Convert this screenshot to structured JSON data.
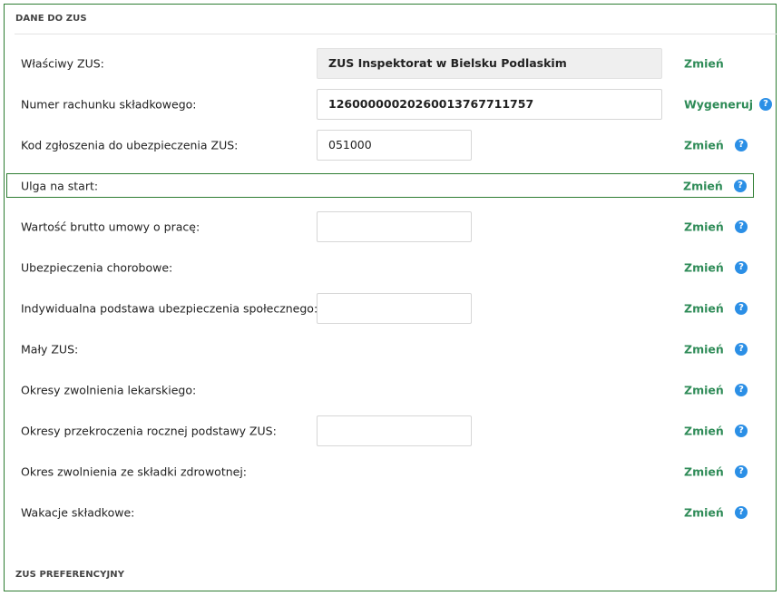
{
  "sections": {
    "main_title": "DANE DO ZUS",
    "next_title": "ZUS PREFERENCYJNY"
  },
  "rows": [
    {
      "label": "Właściwy ZUS:",
      "value": "ZUS Inspektorat w Bielsku Podlaskim",
      "action": "Zmień"
    },
    {
      "label": "Numer rachunku składkowego:",
      "value": "12600000020260013767711757",
      "action": "Wygeneruj",
      "help": "?"
    },
    {
      "label": "Kod zgłoszenia do ubezpieczenia ZUS:",
      "value": "051000",
      "action": "Zmień",
      "help": "?"
    },
    {
      "label": "Ulga na start:",
      "action": "Zmień",
      "help": "?"
    },
    {
      "label": "Wartość brutto umowy o pracę:",
      "value": "",
      "action": "Zmień",
      "help": "?"
    },
    {
      "label": "Ubezpieczenia chorobowe:",
      "action": "Zmień",
      "help": "?"
    },
    {
      "label": "Indywidualna podstawa ubezpieczenia społecznego:",
      "value": "",
      "action": "Zmień",
      "help": "?"
    },
    {
      "label": "Mały ZUS:",
      "action": "Zmień",
      "help": "?"
    },
    {
      "label": "Okresy zwolnienia lekarskiego:",
      "action": "Zmień",
      "help": "?"
    },
    {
      "label": "Okresy przekroczenia rocznej podstawy ZUS:",
      "value": "",
      "action": "Zmień",
      "help": "?"
    },
    {
      "label": "Okres zwolnienia ze składki zdrowotnej:",
      "action": "Zmień",
      "help": "?"
    },
    {
      "label": "Wakacje składkowe:",
      "action": "Zmień",
      "help": "?"
    }
  ],
  "colors": {
    "frame_border": "#2e7d32",
    "action_link": "#2e8b57",
    "help_icon": "#2b8fe6",
    "readonly_field": "#efefef"
  },
  "icons": {
    "help": "question-circle-icon"
  }
}
